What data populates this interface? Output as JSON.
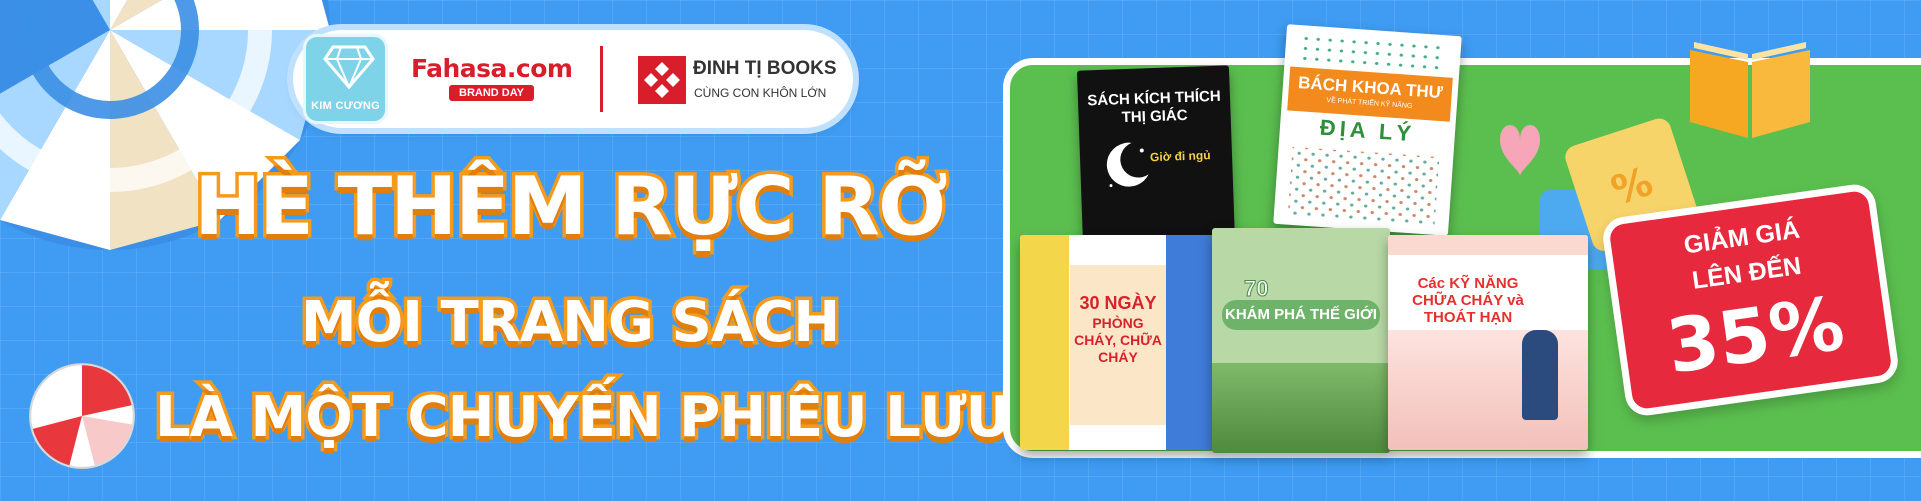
{
  "brand_bar": {
    "tier_badge": "KIM CƯƠNG",
    "fahasa_name": "Fahasa.com",
    "fahasa_event": "BRAND DAY",
    "partner_name": "ĐINH TỊ BOOKS",
    "partner_tagline": "CÙNG CON KHÔN LỚN"
  },
  "headline": {
    "line1": "HÈ THÊM RỰC RỠ",
    "line2": "MỖI TRANG SÁCH",
    "line3": "LÀ MỘT CHUYẾN PHIÊU LƯU!"
  },
  "books": [
    {
      "title": "SÁCH KÍCH THÍCH THỊ GIÁC",
      "subtitle": "Giờ đi ngủ"
    },
    {
      "title": "BÁCH KHOA THƯ",
      "subtitle": "VỀ PHÁT TRIỂN KỸ NĂNG",
      "highlight": "ĐỊA LÝ"
    },
    {
      "number": "30 NGÀY",
      "title": "PHÒNG CHÁY, CHỮA CHÁY"
    },
    {
      "number": "70",
      "title": "KHÁM PHÁ THẾ GIỚI"
    },
    {
      "title": "Các KỸ NĂNG CHỮA CHÁY và THOÁT HẠN"
    }
  ],
  "discount": {
    "line1": "GIẢM GIÁ",
    "line2": "LÊN ĐẾN",
    "value": "35%"
  },
  "colors": {
    "background": "#3f9cf2",
    "headline_outline": "#f49a1c",
    "panel": "#5bbf4f",
    "discount": "#e7293d",
    "brand_red": "#d81e2b"
  },
  "icons": [
    "diamond-icon",
    "dinhti-logo-icon",
    "umbrella-icon",
    "beach-ball-icon",
    "open-book-icon",
    "coupon-icon",
    "heart-icon",
    "moon-icon"
  ]
}
